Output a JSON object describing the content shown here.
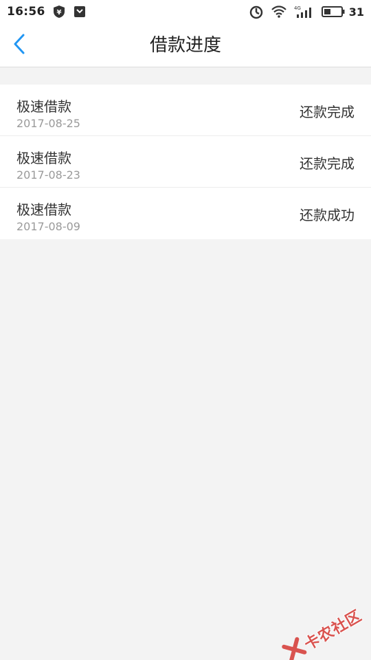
{
  "status_bar": {
    "time": "16:56",
    "battery_level": "31",
    "network_label": "4G"
  },
  "header": {
    "title": "借款进度"
  },
  "loans": [
    {
      "name": "极速借款",
      "date": "2017-08-25",
      "status": "还款完成"
    },
    {
      "name": "极速借款",
      "date": "2017-08-23",
      "status": "还款完成"
    },
    {
      "name": "极速借款",
      "date": "2017-08-09",
      "status": "还款成功"
    }
  ],
  "watermark": {
    "text": "卡农社区"
  },
  "colors": {
    "accent": "#2196f3",
    "background": "#f3f3f3",
    "watermark": "#d9534f"
  }
}
